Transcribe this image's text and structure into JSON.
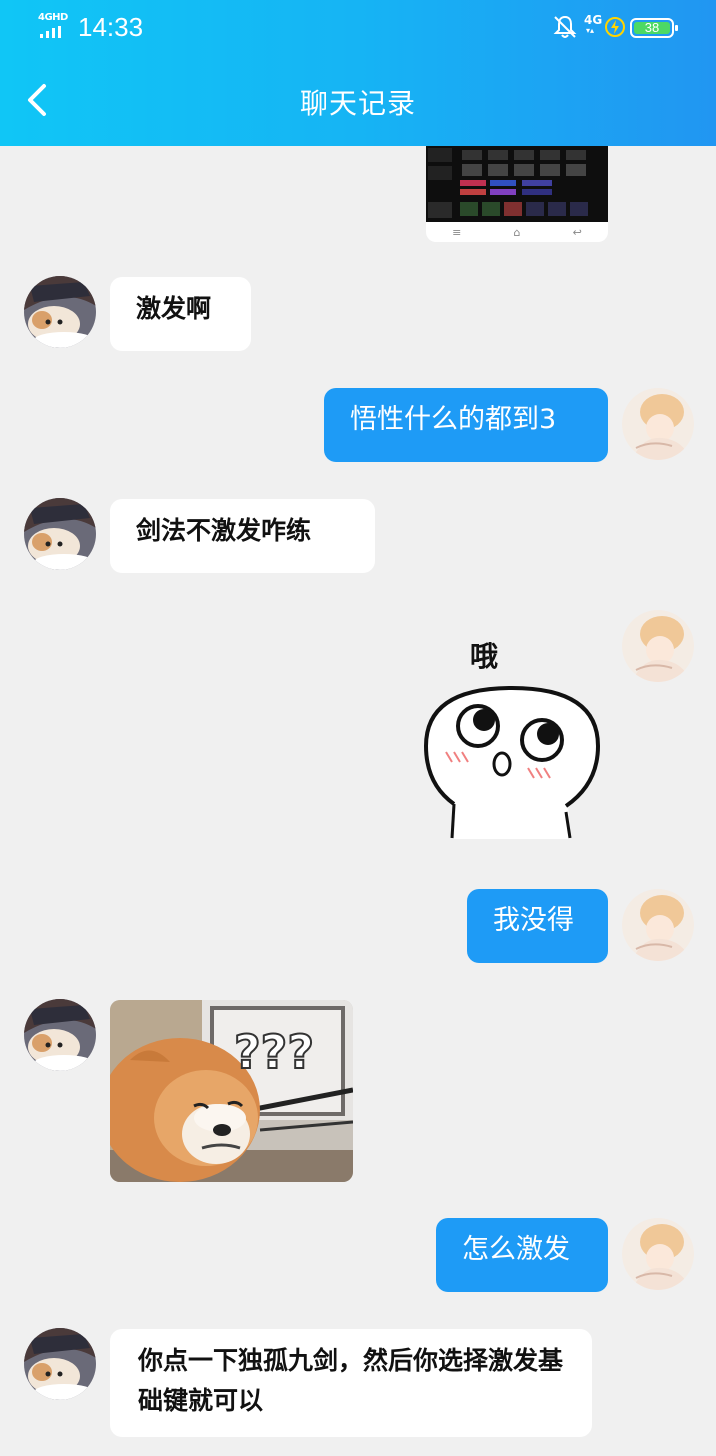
{
  "status_bar": {
    "network": "4GHD",
    "time": "14:33",
    "network_right": "4G",
    "battery": "38"
  },
  "header": {
    "title": "聊天记录"
  },
  "messages": [
    {
      "side": "left",
      "type": "text",
      "text": "激发啊"
    },
    {
      "side": "right",
      "type": "text",
      "text": "悟性什么的都到3"
    },
    {
      "side": "left",
      "type": "text",
      "text": "剑法不激发咋练"
    },
    {
      "side": "right",
      "type": "sticker",
      "caption": "哦"
    },
    {
      "side": "right",
      "type": "text",
      "text": "我没得"
    },
    {
      "side": "left",
      "type": "image",
      "caption": "???"
    },
    {
      "side": "right",
      "type": "text",
      "text": "怎么激发"
    },
    {
      "side": "left",
      "type": "text",
      "text": "你点一下独孤九剑，然后你选择激发基础键就可以"
    }
  ],
  "colors": {
    "header_start": "#10c6f6",
    "header_end": "#2196f2",
    "bubble_right": "#1e9bf6",
    "bubble_left": "#ffffff",
    "chat_background": "#f0f0f0"
  },
  "icons": [
    "back-arrow-icon",
    "signal-icon",
    "mute-bell-icon",
    "charging-icon",
    "battery-icon"
  ]
}
